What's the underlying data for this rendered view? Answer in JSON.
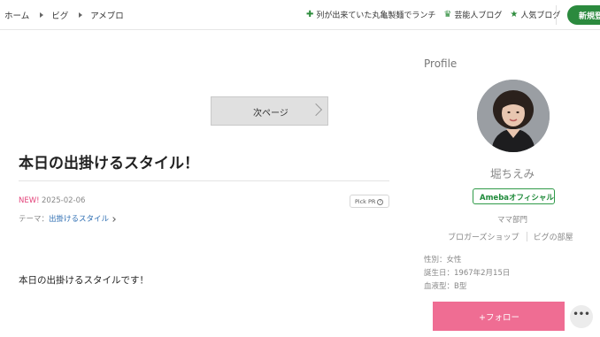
{
  "breadcrumb": {
    "items": [
      "ホーム",
      "ビグ",
      "アメブロ"
    ]
  },
  "nav": {
    "links": [
      {
        "icon": "plus-icon",
        "label": "列が出来ていた丸亀製麺でランチ"
      },
      {
        "icon": "crown-icon",
        "label": "芸能人ブログ"
      },
      {
        "icon": "star-icon",
        "label": "人気ブログ"
      }
    ],
    "signup_label": "新規登"
  },
  "pager": {
    "next_label": "次ページ"
  },
  "entry": {
    "title": "本日の出掛けるスタイル！",
    "new_badge": "NEW!",
    "date": "2025-02-06",
    "pick_pr_label": "Pick PR",
    "theme_label": "テーマ：",
    "theme_value": "出掛けるスタイル",
    "body": "本日の出掛けるスタイルです！"
  },
  "profile": {
    "heading": "Profile",
    "name": "堀ちえみ",
    "official_badge": "Amebaオフィシャル",
    "category": "ママ部門",
    "links": [
      "ブロガーズショップ",
      "ビグの部屋"
    ],
    "gender": "性別：女性",
    "birthday": "誕生日：1967年2月15日",
    "blood_type": "血液型：B型",
    "follow_label": "+フォロー",
    "more_label": "•••"
  },
  "colors": {
    "brand_green": "#2b8a3e",
    "follow_pink": "#ef6d93",
    "link_blue": "#2f6fb3",
    "new_pink": "#e3437a"
  }
}
